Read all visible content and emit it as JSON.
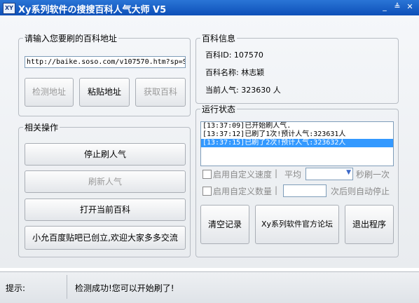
{
  "window": {
    "icon_text": "XY",
    "title": "Xy系列软件の搜搜百科人气大师 V5",
    "minimize": "_",
    "restore": "≜",
    "close": "✕"
  },
  "url_group": {
    "legend": "请输入您要刷的百科地址",
    "url_value": "http://baike.soso.com/v107570.htm?sp=S",
    "check_label": "检测地址",
    "paste_label": "粘贴地址",
    "fetch_label": "获取百科"
  },
  "ops_group": {
    "legend": "相关操作",
    "stop_label": "停止刷人气",
    "refresh_label": "刷新人气",
    "open_label": "打开当前百科",
    "baidu_label": "小允百度贴吧已创立,欢迎大家多多交流"
  },
  "info_group": {
    "legend": "百科信息",
    "id_line": "百科ID:  107570",
    "name_line": "百科名称: 林志颖",
    "pop_line": "当前人气: 323630 人"
  },
  "status_group": {
    "legend": "运行状态",
    "log": [
      "[13:37:09]已开始刷人气.",
      "[13:37:12]已刷了1次!预计人气:323631人",
      "[13:37:15]已刷了2次!预计人气:323632人"
    ],
    "custom_speed_label": "启用自定义速度",
    "sep1": "|",
    "avg_label": "平均",
    "per_label": "秒刷一次",
    "custom_count_label": "启用自定义数量",
    "sep2": "|",
    "auto_stop_label": "次后则自动停止",
    "clear_label": "清空记录",
    "forum_label": "Xy系列软件官方论坛",
    "exit_label": "退出程序"
  },
  "statusbar": {
    "label": "提示:",
    "text": "检测成功!您可以开始刷了!"
  }
}
